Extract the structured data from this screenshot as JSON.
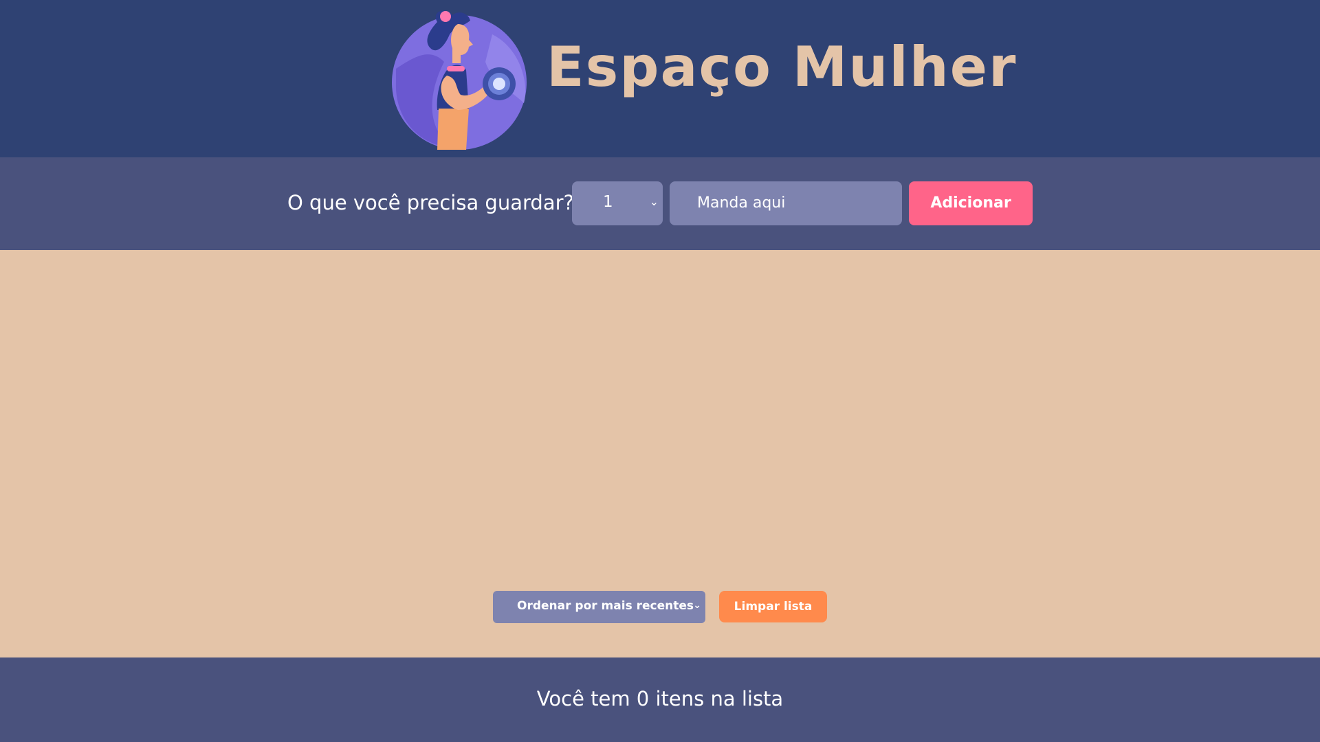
{
  "header": {
    "brand": "Espaço Mulher",
    "logo_icon": "woman-lifting-dumbbell-icon"
  },
  "form": {
    "label": "O que você precisa guardar?",
    "quantity_value": "1",
    "item_placeholder": "Manda aqui",
    "add_label": "Adicionar"
  },
  "controls": {
    "sort_value": "Ordenar por mais recentes",
    "clear_label": "Limpar lista"
  },
  "footer": {
    "text": "Você tem 0 itens na lista"
  },
  "colors": {
    "header_bg": "#2F4273",
    "bar_bg": "#4A527D",
    "main_bg": "#E4C4A8",
    "brand_text": "#E4C4A8",
    "field_bg": "#7E83AF",
    "add_button": "#FF6489",
    "clear_button": "#FF8A4C"
  }
}
